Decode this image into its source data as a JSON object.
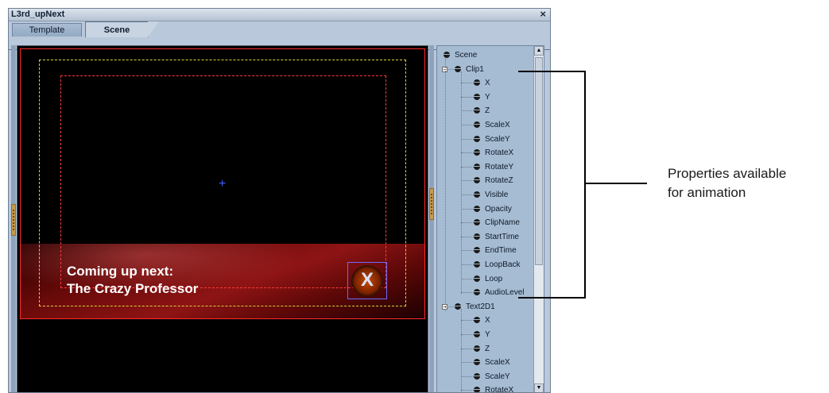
{
  "window": {
    "title": "L3rd_upNext",
    "close_glyph": "×"
  },
  "tabs": [
    {
      "label": "Template",
      "active": false
    },
    {
      "label": "Scene",
      "active": true
    }
  ],
  "preview": {
    "line1": "Coming up next:",
    "line2": "The Crazy Professor",
    "logo_glyph": "X",
    "colors": {
      "frame": "#ff2a2a",
      "action_safe": "#d9d23a",
      "title_safe": "#ff3b3b",
      "crosshair": "#3d5cff"
    }
  },
  "tree": {
    "root": "Scene",
    "nodes": [
      {
        "label": "Clip1",
        "children": [
          "X",
          "Y",
          "Z",
          "ScaleX",
          "ScaleY",
          "RotateX",
          "RotateY",
          "RotateZ",
          "Visible",
          "Opacity",
          "ClipName",
          "StartTime",
          "EndTime",
          "LoopBack",
          "Loop",
          "AudioLevel"
        ]
      },
      {
        "label": "Text2D1",
        "children": [
          "X",
          "Y",
          "Z",
          "ScaleX",
          "ScaleY",
          "RotateX"
        ]
      }
    ]
  },
  "callout": {
    "line1": "Properties available",
    "line2": "for animation"
  }
}
